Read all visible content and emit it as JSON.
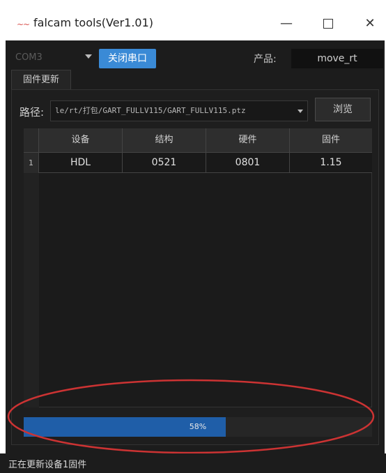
{
  "window": {
    "title": "falcam tools(Ver1.01)",
    "controls": {
      "minimize": "—",
      "close": "✕"
    }
  },
  "toolbar": {
    "port_select_value": "COM3",
    "close_port_label": "关闭串口",
    "product_label": "产品:",
    "product_value": "move_rt"
  },
  "tab": {
    "label": "固件更新"
  },
  "path": {
    "label": "路径:",
    "value": "le/rt/打包/GART_FULLV115/GART_FULLV115.ptz",
    "browse_label": "浏览"
  },
  "table": {
    "headers": [
      "设备",
      "结构",
      "硬件",
      "固件"
    ],
    "rows": [
      {
        "index": "1",
        "cells": [
          "HDL",
          "0521",
          "0801",
          "1.15"
        ]
      }
    ]
  },
  "progress": {
    "value": 0.58,
    "label": "58%"
  },
  "status": {
    "text": "正在更新设备1固件"
  },
  "colors": {
    "accent": "#3a8ad6",
    "progress": "#1f5ea8",
    "annotation": "#cc3333",
    "background": "#1c1c1c"
  }
}
